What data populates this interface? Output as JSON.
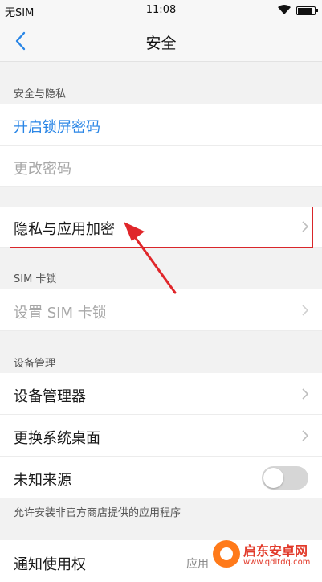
{
  "status_bar": {
    "carrier": "无SIM",
    "time": "11:08",
    "battery_level": 0.9
  },
  "nav": {
    "title": "安全"
  },
  "sections": {
    "privacy": {
      "header": "安全与隐私",
      "enable_lock": "开启锁屏密码",
      "change_password": "更改密码"
    },
    "app_encrypt": {
      "label": "隐私与应用加密"
    },
    "sim": {
      "header": "SIM 卡锁",
      "set_sim_lock": "设置 SIM 卡锁"
    },
    "device": {
      "header": "设备管理",
      "device_manager": "设备管理器",
      "change_launcher": "更换系统桌面",
      "unknown_sources": "未知来源",
      "unknown_sources_enabled": false,
      "unknown_sources_note": "允许安装非官方商店提供的应用程序"
    },
    "notification": {
      "label": "通知使用权",
      "value": "应用"
    }
  },
  "watermark": {
    "title": "启东安卓网",
    "url": "www.qdltdq.com"
  },
  "colors": {
    "accent": "#2a86e6",
    "highlight": "#d9262a",
    "background": "#f2f2f2"
  },
  "icons": [
    "back-chevron-icon",
    "wifi-icon",
    "battery-icon",
    "chevron-right-icon"
  ]
}
